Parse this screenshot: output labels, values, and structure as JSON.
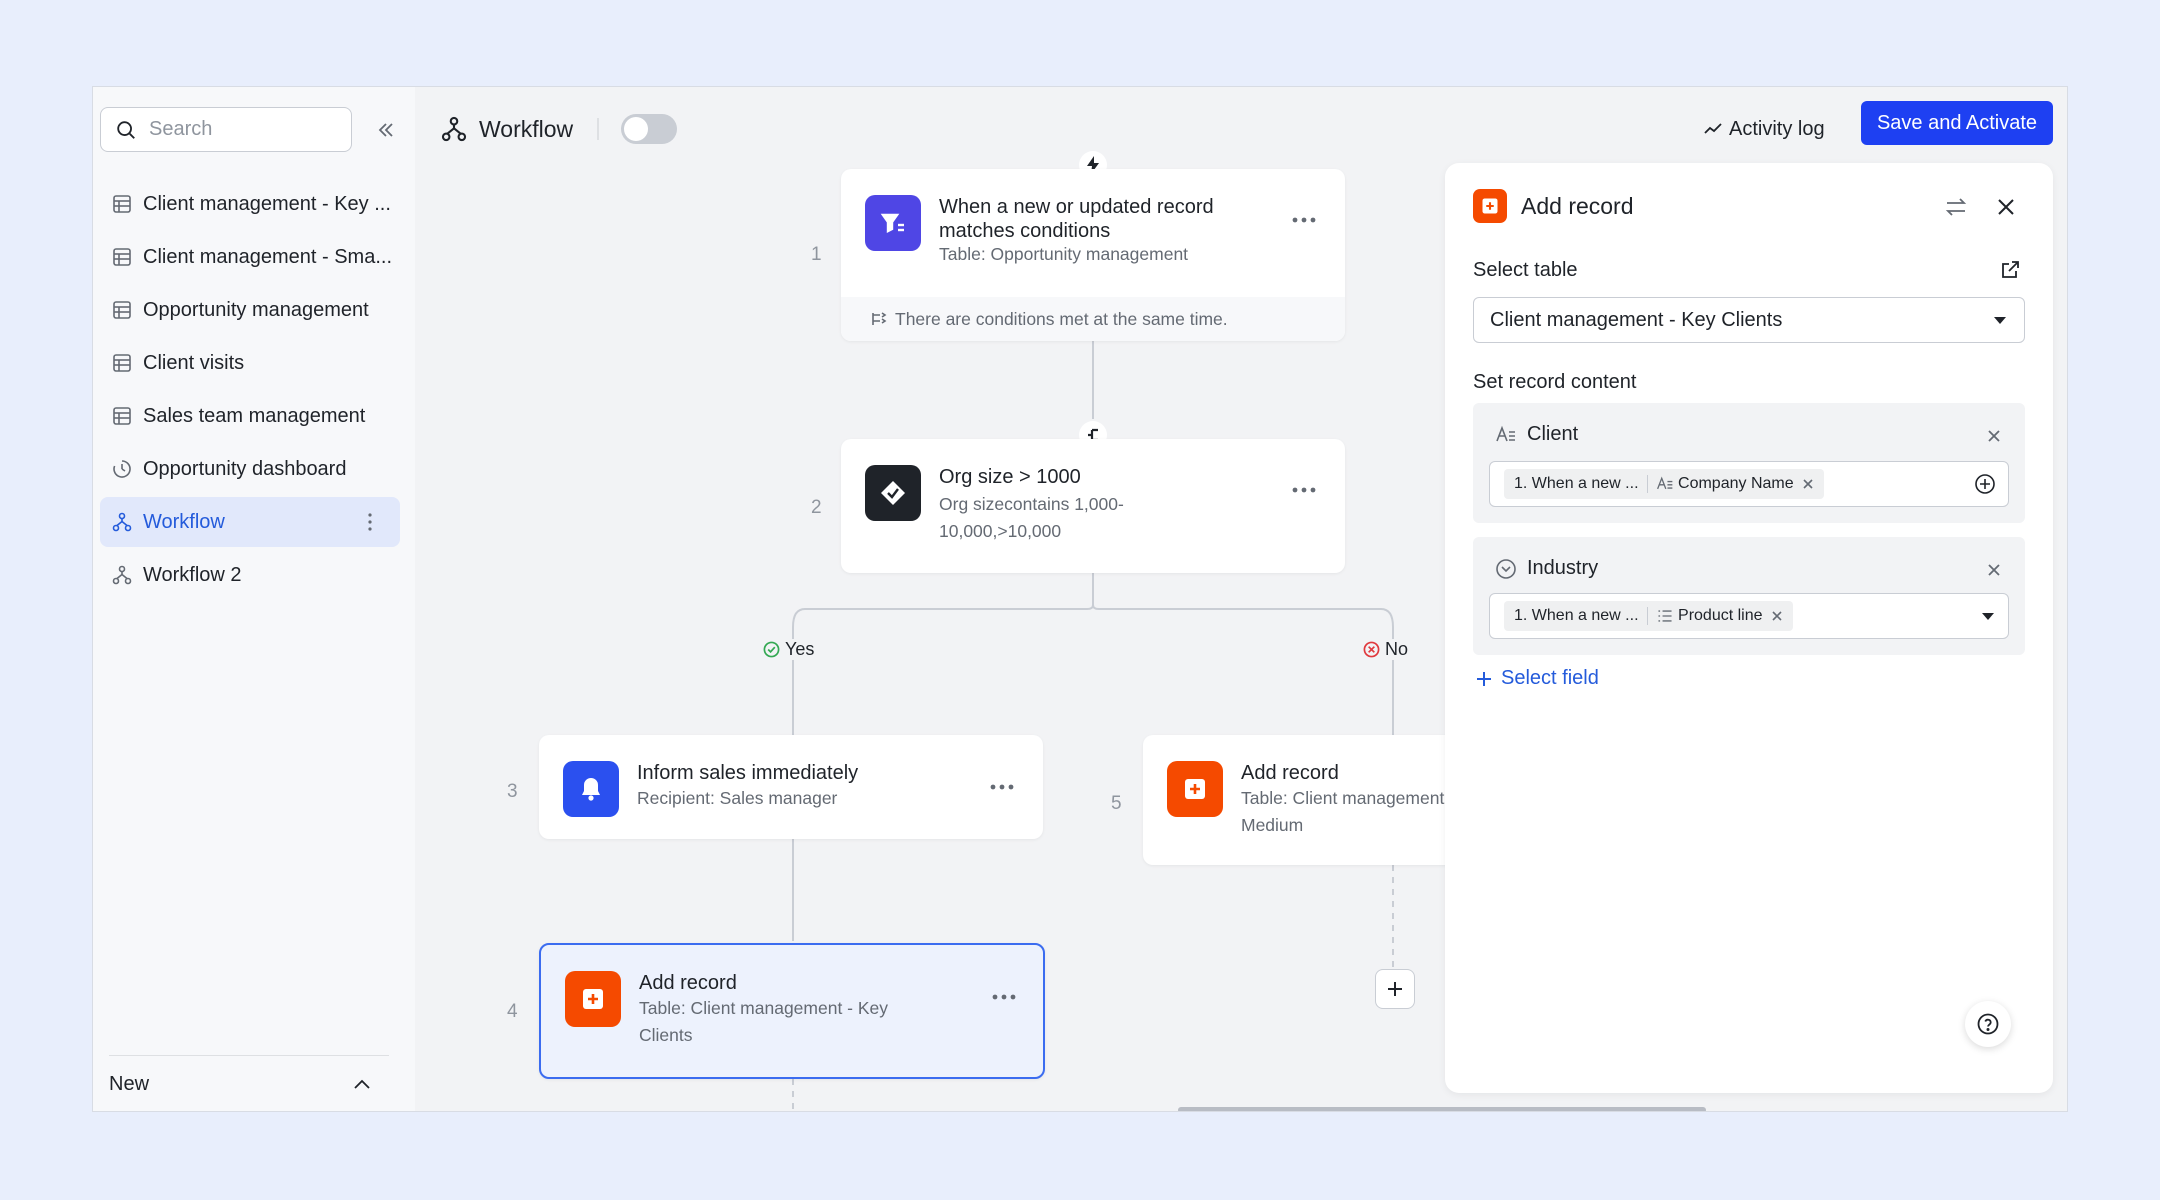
{
  "sidebar": {
    "search_placeholder": "Search",
    "items": [
      {
        "label": "Client management - Key ...",
        "icon": "table-icon"
      },
      {
        "label": "Client management - Sma...",
        "icon": "table-icon"
      },
      {
        "label": "Opportunity management",
        "icon": "table-icon"
      },
      {
        "label": "Client visits",
        "icon": "table-icon"
      },
      {
        "label": "Sales team management",
        "icon": "table-icon"
      },
      {
        "label": "Opportunity dashboard",
        "icon": "dashboard-icon"
      },
      {
        "label": "Workflow",
        "icon": "workflow-icon",
        "active": true
      },
      {
        "label": "Workflow 2",
        "icon": "workflow-icon"
      }
    ],
    "footer_label": "New"
  },
  "header": {
    "title": "Workflow",
    "toggle_on": false,
    "activity_label": "Activity log",
    "save_label": "Save and Activate"
  },
  "workflow": {
    "step1": {
      "number": "1",
      "title": "When a new or updated record matches conditions",
      "subtitle": "Table: Opportunity management",
      "footer": "There are conditions met at the same time."
    },
    "step2": {
      "number": "2",
      "title": "Org size > 1000",
      "subtitle": "Org sizecontains 1,000-10,000,>10,000"
    },
    "yes_label": "Yes",
    "no_label": "No",
    "step3": {
      "number": "3",
      "title": "Inform sales immediately",
      "subtitle": "Recipient: Sales manager"
    },
    "step4": {
      "number": "4",
      "title": "Add record",
      "subtitle": "Table: Client management - Key Clients"
    },
    "step5": {
      "number": "5",
      "title": "Add record",
      "subtitle": "Table: Client management - Small & Medium"
    }
  },
  "panel": {
    "title": "Add record",
    "select_table_label": "Select table",
    "selected_table": "Client management - Key Clients",
    "set_content_label": "Set record content",
    "fields": [
      {
        "name": "Client",
        "chip_source": "1. When a new ...",
        "chip_field": "Company Name"
      },
      {
        "name": "Industry",
        "chip_source": "1. When a new ...",
        "chip_field": "Product line"
      }
    ],
    "select_field_label": "Select field"
  },
  "colors": {
    "accent": "#1e40f2",
    "trigger": "#4f46e5",
    "condition": "#1f2329",
    "notify": "#2b50ef",
    "record": "#f54a00"
  }
}
